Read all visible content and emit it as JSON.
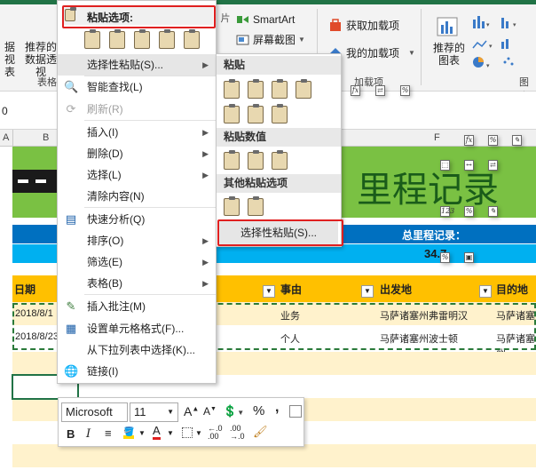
{
  "ribbon": {
    "smartart": "SmartArt",
    "screenshot": "屏幕截图",
    "get_addins": "获取加载项",
    "my_addins": "我的加载项",
    "addins_group": "加载项",
    "recommended_charts": "推荐的\n图表",
    "recommended_charts_l1": "推荐的",
    "recommended_charts_l2": "图表",
    "left_frag1_l1": "据",
    "left_frag1_l2": "视表",
    "left_frag2_l1": "推荐的",
    "left_frag2_l2": "数据透视",
    "table_group_frag": "表格",
    "right_group_frag": "图表"
  },
  "formula": {
    "cell_ref": "0"
  },
  "columns": {
    "a": "A",
    "b": "B",
    "f": "F"
  },
  "sheet": {
    "title": "里程记录",
    "total_label": "总里程记录：",
    "total_value": "34.7",
    "headers": {
      "date": "日期",
      "reason": "事由",
      "from": "出发地",
      "to": "目的地"
    },
    "rows": [
      {
        "date": "2018/8/1",
        "reason": "业务",
        "from": "马萨诸塞州弗雷明汉",
        "to": "马萨诸塞州"
      },
      {
        "date": "2018/8/23",
        "reason": "个人",
        "from": "马萨诸塞州波士顿",
        "to": "马萨诸塞州"
      }
    ]
  },
  "context_menu": {
    "paste_options_label": "粘贴选项:",
    "items": [
      {
        "label": "选择性粘贴(S)...",
        "arrow": true
      },
      {
        "label": "智能查找(L)"
      },
      {
        "label": "刷新(R)",
        "disabled": true
      },
      {
        "label": "插入(I)",
        "arrow": true
      },
      {
        "label": "删除(D)",
        "arrow": true
      },
      {
        "label": "选择(L)",
        "arrow": true
      },
      {
        "label": "清除内容(N)"
      },
      {
        "label": "快速分析(Q)"
      },
      {
        "label": "排序(O)",
        "arrow": true
      },
      {
        "label": "筛选(E)",
        "arrow": true
      },
      {
        "label": "表格(B)",
        "arrow": true
      },
      {
        "label": "插入批注(M)"
      },
      {
        "label": "设置单元格格式(F)..."
      },
      {
        "label": "从下拉列表中选择(K)..."
      },
      {
        "label": "链接(I)"
      }
    ]
  },
  "submenu": {
    "paste_header": "粘贴",
    "paste_values_header": "粘贴数值",
    "other_header": "其他粘贴选项",
    "paste_special": "选择性粘贴(S)..."
  },
  "mini_toolbar": {
    "font": "Microsoft",
    "size": "11",
    "bold": "B",
    "italic": "I",
    "percent": "%",
    "comma": ","
  },
  "colors": {
    "green": "#7ac143",
    "blue": "#0070c0",
    "cyan": "#00b0f0",
    "orange": "#ffc000",
    "light_orange": "#fff2cc",
    "red_outline": "#e02020",
    "excel_green": "#217346"
  }
}
